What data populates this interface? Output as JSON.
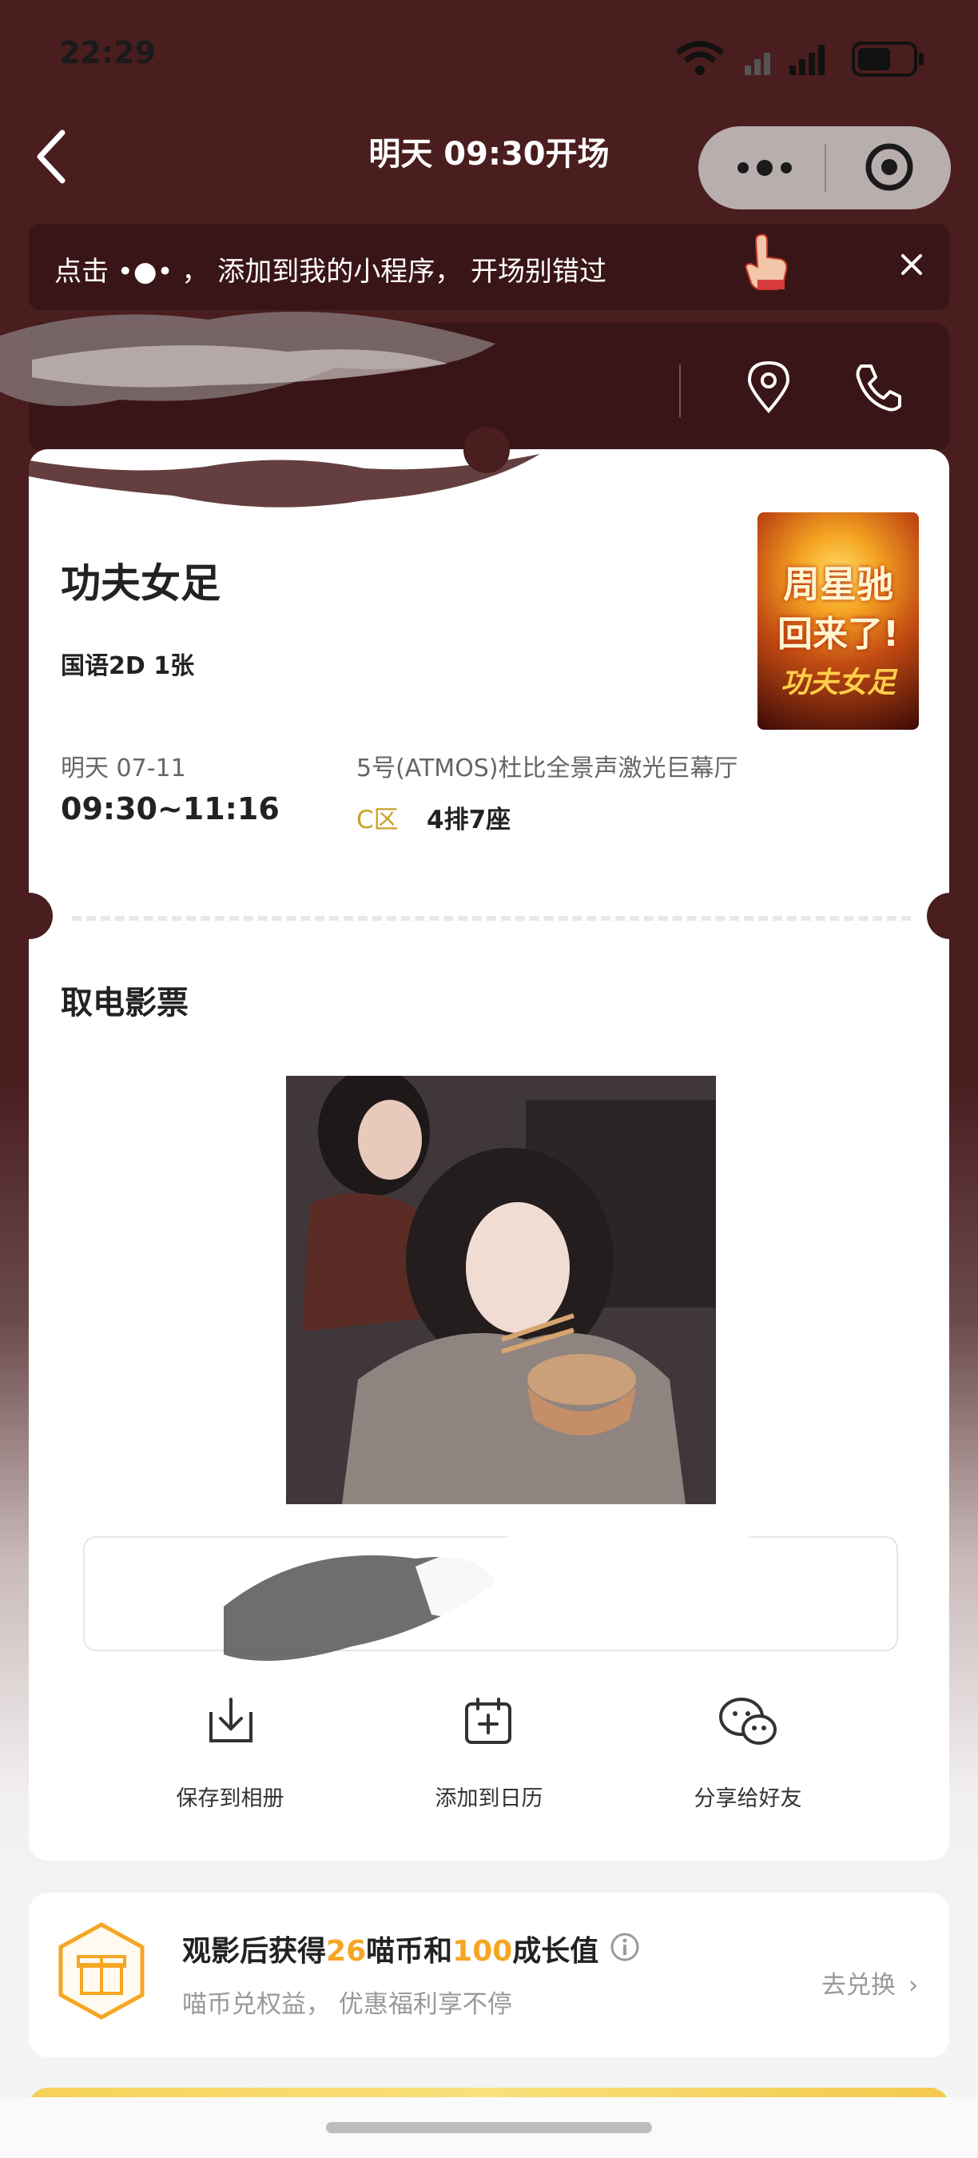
{
  "status_bar": {
    "time": "22:29"
  },
  "navbar": {
    "title": "明天 09:30开场"
  },
  "tip": {
    "text": "点击 •●• ， 添加到我的小程序， 开场别错过"
  },
  "movie": {
    "title": "功夫女足",
    "format_count": "国语2D  1张",
    "date": "明天  07-11",
    "time_range": "09:30~11:16",
    "hall": "5号(ATMOS)杜比全景声激光巨幕厅",
    "zone": "C区",
    "seat": "4排7座",
    "poster": {
      "line1": "周星驰",
      "line2": "回来了!",
      "line3": "功夫女足"
    }
  },
  "ticket_pickup": {
    "title": "取电影票"
  },
  "actions": [
    {
      "label": "保存到相册"
    },
    {
      "label": "添加到日历"
    },
    {
      "label": "分享给好友"
    }
  ],
  "reward": {
    "prefix": "观影后获得",
    "coins": "26",
    "mid": "喵币和",
    "growth": "100",
    "suffix": "成长值",
    "subtitle": "喵币兑权益， 优惠福利享不停",
    "redeem": "去兑换",
    "redeem_arrow": "›"
  },
  "colors": {
    "theme_dark": "#4a1d1f",
    "accent_orange": "#f5a623",
    "zone_gold": "#c9a227"
  }
}
